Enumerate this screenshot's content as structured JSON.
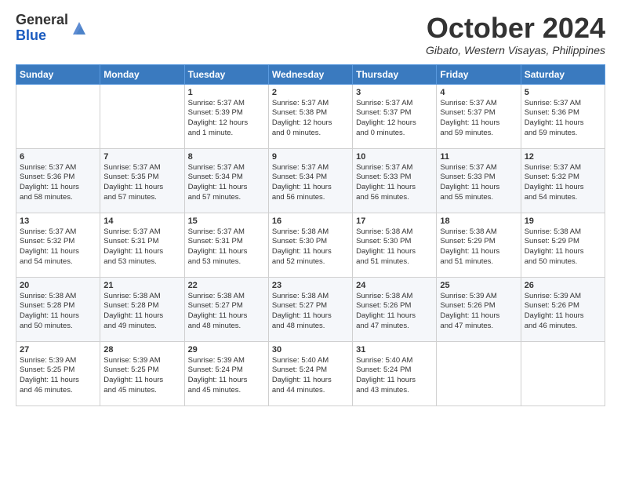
{
  "header": {
    "logo_general": "General",
    "logo_blue": "Blue",
    "month_title": "October 2024",
    "location": "Gibato, Western Visayas, Philippines"
  },
  "weekdays": [
    "Sunday",
    "Monday",
    "Tuesday",
    "Wednesday",
    "Thursday",
    "Friday",
    "Saturday"
  ],
  "weeks": [
    [
      {
        "day": "",
        "info": ""
      },
      {
        "day": "",
        "info": ""
      },
      {
        "day": "1",
        "info": "Sunrise: 5:37 AM\nSunset: 5:39 PM\nDaylight: 12 hours\nand 1 minute."
      },
      {
        "day": "2",
        "info": "Sunrise: 5:37 AM\nSunset: 5:38 PM\nDaylight: 12 hours\nand 0 minutes."
      },
      {
        "day": "3",
        "info": "Sunrise: 5:37 AM\nSunset: 5:37 PM\nDaylight: 12 hours\nand 0 minutes."
      },
      {
        "day": "4",
        "info": "Sunrise: 5:37 AM\nSunset: 5:37 PM\nDaylight: 11 hours\nand 59 minutes."
      },
      {
        "day": "5",
        "info": "Sunrise: 5:37 AM\nSunset: 5:36 PM\nDaylight: 11 hours\nand 59 minutes."
      }
    ],
    [
      {
        "day": "6",
        "info": "Sunrise: 5:37 AM\nSunset: 5:36 PM\nDaylight: 11 hours\nand 58 minutes."
      },
      {
        "day": "7",
        "info": "Sunrise: 5:37 AM\nSunset: 5:35 PM\nDaylight: 11 hours\nand 57 minutes."
      },
      {
        "day": "8",
        "info": "Sunrise: 5:37 AM\nSunset: 5:34 PM\nDaylight: 11 hours\nand 57 minutes."
      },
      {
        "day": "9",
        "info": "Sunrise: 5:37 AM\nSunset: 5:34 PM\nDaylight: 11 hours\nand 56 minutes."
      },
      {
        "day": "10",
        "info": "Sunrise: 5:37 AM\nSunset: 5:33 PM\nDaylight: 11 hours\nand 56 minutes."
      },
      {
        "day": "11",
        "info": "Sunrise: 5:37 AM\nSunset: 5:33 PM\nDaylight: 11 hours\nand 55 minutes."
      },
      {
        "day": "12",
        "info": "Sunrise: 5:37 AM\nSunset: 5:32 PM\nDaylight: 11 hours\nand 54 minutes."
      }
    ],
    [
      {
        "day": "13",
        "info": "Sunrise: 5:37 AM\nSunset: 5:32 PM\nDaylight: 11 hours\nand 54 minutes."
      },
      {
        "day": "14",
        "info": "Sunrise: 5:37 AM\nSunset: 5:31 PM\nDaylight: 11 hours\nand 53 minutes."
      },
      {
        "day": "15",
        "info": "Sunrise: 5:37 AM\nSunset: 5:31 PM\nDaylight: 11 hours\nand 53 minutes."
      },
      {
        "day": "16",
        "info": "Sunrise: 5:38 AM\nSunset: 5:30 PM\nDaylight: 11 hours\nand 52 minutes."
      },
      {
        "day": "17",
        "info": "Sunrise: 5:38 AM\nSunset: 5:30 PM\nDaylight: 11 hours\nand 51 minutes."
      },
      {
        "day": "18",
        "info": "Sunrise: 5:38 AM\nSunset: 5:29 PM\nDaylight: 11 hours\nand 51 minutes."
      },
      {
        "day": "19",
        "info": "Sunrise: 5:38 AM\nSunset: 5:29 PM\nDaylight: 11 hours\nand 50 minutes."
      }
    ],
    [
      {
        "day": "20",
        "info": "Sunrise: 5:38 AM\nSunset: 5:28 PM\nDaylight: 11 hours\nand 50 minutes."
      },
      {
        "day": "21",
        "info": "Sunrise: 5:38 AM\nSunset: 5:28 PM\nDaylight: 11 hours\nand 49 minutes."
      },
      {
        "day": "22",
        "info": "Sunrise: 5:38 AM\nSunset: 5:27 PM\nDaylight: 11 hours\nand 48 minutes."
      },
      {
        "day": "23",
        "info": "Sunrise: 5:38 AM\nSunset: 5:27 PM\nDaylight: 11 hours\nand 48 minutes."
      },
      {
        "day": "24",
        "info": "Sunrise: 5:38 AM\nSunset: 5:26 PM\nDaylight: 11 hours\nand 47 minutes."
      },
      {
        "day": "25",
        "info": "Sunrise: 5:39 AM\nSunset: 5:26 PM\nDaylight: 11 hours\nand 47 minutes."
      },
      {
        "day": "26",
        "info": "Sunrise: 5:39 AM\nSunset: 5:26 PM\nDaylight: 11 hours\nand 46 minutes."
      }
    ],
    [
      {
        "day": "27",
        "info": "Sunrise: 5:39 AM\nSunset: 5:25 PM\nDaylight: 11 hours\nand 46 minutes."
      },
      {
        "day": "28",
        "info": "Sunrise: 5:39 AM\nSunset: 5:25 PM\nDaylight: 11 hours\nand 45 minutes."
      },
      {
        "day": "29",
        "info": "Sunrise: 5:39 AM\nSunset: 5:24 PM\nDaylight: 11 hours\nand 45 minutes."
      },
      {
        "day": "30",
        "info": "Sunrise: 5:40 AM\nSunset: 5:24 PM\nDaylight: 11 hours\nand 44 minutes."
      },
      {
        "day": "31",
        "info": "Sunrise: 5:40 AM\nSunset: 5:24 PM\nDaylight: 11 hours\nand 43 minutes."
      },
      {
        "day": "",
        "info": ""
      },
      {
        "day": "",
        "info": ""
      }
    ]
  ]
}
